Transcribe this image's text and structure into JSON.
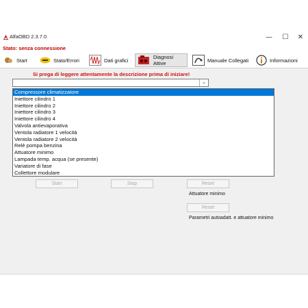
{
  "window": {
    "title": "AlfaOBD 2.3.7.0",
    "minimize_symbol": "—",
    "maximize_symbol": "☐",
    "close_symbol": "✕"
  },
  "status": "Stato: senza connessione",
  "tabs": [
    {
      "label": "Start",
      "icon": "car-icon"
    },
    {
      "label": "Stato/Errori",
      "icon": "error-badge-icon"
    },
    {
      "label": "Dati grafici",
      "icon": "waveform-icon"
    },
    {
      "label": "Diagnosi Attive",
      "icon": "engine-icon",
      "active": true
    },
    {
      "label": "Manuale Collegati",
      "icon": "manual-icon"
    },
    {
      "label": "Informazioni",
      "icon": "info-icon"
    }
  ],
  "main": {
    "warning": "Si prega di leggere attentamente la descrizione prima di iniziare!",
    "combo_value": "",
    "dropdown_items": [
      "Compressore climatizzatore",
      "Iniettore cilindro 1",
      "Iniettore cilindro 2",
      "Iniettore cilindro 3",
      "Iniettore cilindro 4",
      "Valvola antievaporativa",
      "Ventola radiatore 1 velocità",
      "Ventola radiatore 2 velocità",
      "Relè pompa benzina",
      "Attuatore minimo",
      "Lampada temp. acqua (se presente)",
      "Variatore di fase",
      "Collettore modulare"
    ],
    "selected_index": 0,
    "buttons": {
      "start": "Start",
      "stop": "Stop",
      "reset1": "Reset",
      "reset2": "Reset"
    },
    "caption1": "Attuatore minimo",
    "caption2": "Parametri autoadatt. e attuatore minimo"
  },
  "colors": {
    "status_red": "#c00000",
    "selection_blue": "#0078d7",
    "content_gray": "#f0f0f0"
  }
}
